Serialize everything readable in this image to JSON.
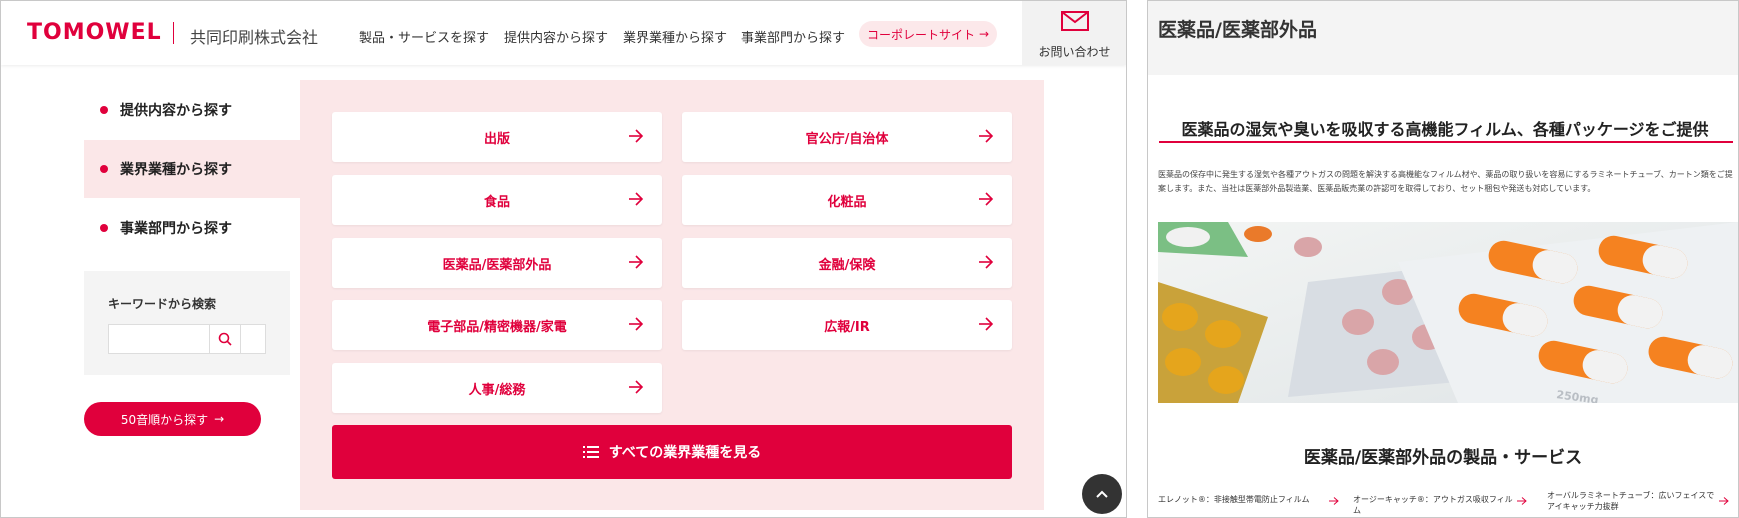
{
  "left": {
    "header": {
      "logo": "TOMOWEL",
      "company": "共同印刷株式会社",
      "nav": [
        "製品・サービスを探す",
        "提供内容から探す",
        "業界業種から探す",
        "事業部門から探す"
      ],
      "corporate_link": "コーポレートサイト",
      "contact": "お問い合わせ"
    },
    "sidebar": {
      "items": [
        {
          "label": "提供内容から探す",
          "active": false
        },
        {
          "label": "業界業種から探す",
          "active": true
        },
        {
          "label": "事業部門から探す",
          "active": false
        }
      ],
      "keyword_label": "キーワードから検索",
      "keyword_value": "",
      "gojuon_button": "50音順から探す"
    },
    "industries": [
      "出版",
      "官公庁/自治体",
      "食品",
      "化粧品",
      "医薬品/医薬部外品",
      "金融/保険",
      "電子部品/精密機器/家電",
      "広報/IR",
      "人事/総務"
    ],
    "all_button": "すべての業界業種を見る"
  },
  "right": {
    "title": "医薬品/医薬部外品",
    "lead": "医薬品の湿気や臭いを吸収する高機能フィルム、各種パッケージをご提供",
    "body": "医薬品の保存中に発生する湿気や各種アウトガスの問題を解決する高機能なフィルム材や、薬品の取り扱いを容易にするラミネートチューブ、カートン類をご提案します。また、当社は医薬部外品製造業、医薬品販売業の許認可を取得しており、セット梱包や発送も対応しています。",
    "pill_label": "250mg",
    "section_title": "医薬品/医薬部外品の製品・サービス",
    "products": [
      "エレノット®：非接触型帯電防止フィルム",
      "オージーキャッチ®：アウトガス吸収フィルム",
      "オーバルラミネートチューブ：広いフェイスでアイキャッチ力抜群"
    ]
  },
  "colors": {
    "accent": "#e0003c",
    "pink_bg": "#fbe7e8"
  }
}
